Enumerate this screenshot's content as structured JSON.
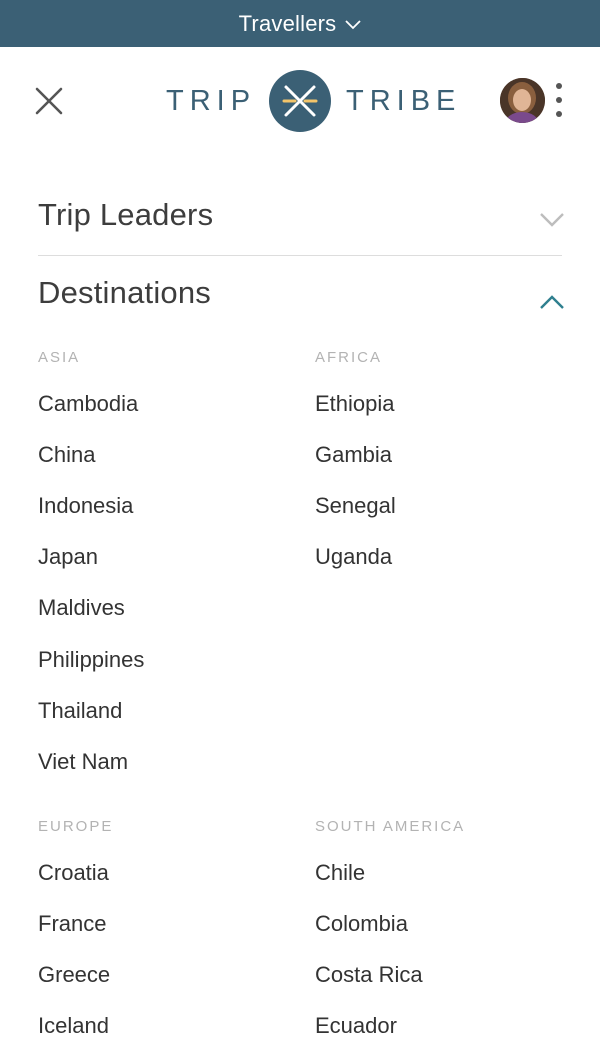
{
  "topbar": {
    "label": "Travellers",
    "icon": "chevron-down-icon"
  },
  "header": {
    "close_icon": "close-icon",
    "logo": {
      "left_word": "TRIP",
      "right_word": "TRIBE",
      "icon": "crossed-arrows-icon"
    },
    "avatar": "user-avatar",
    "menu_icon": "kebab-menu-icon"
  },
  "sections": {
    "trip_leaders": {
      "title": "Trip Leaders",
      "icon": "chevron-down-icon",
      "expanded": false
    },
    "destinations": {
      "title": "Destinations",
      "icon": "chevron-up-icon",
      "expanded": true
    }
  },
  "regions": {
    "asia": {
      "label": "ASIA",
      "items": [
        "Cambodia",
        "China",
        "Indonesia",
        "Japan",
        "Maldives",
        "Philippines",
        "Thailand",
        "Viet Nam"
      ]
    },
    "africa": {
      "label": "AFRICA",
      "items": [
        "Ethiopia",
        "Gambia",
        "Senegal",
        "Uganda"
      ]
    },
    "europe": {
      "label": "EUROPE",
      "items": [
        "Croatia",
        "France",
        "Greece",
        "Iceland"
      ]
    },
    "south_america": {
      "label": "SOUTH AMERICA",
      "items": [
        "Chile",
        "Colombia",
        "Costa Rica",
        "Ecuador"
      ]
    }
  },
  "colors": {
    "brand": "#3b6075",
    "accent_teal": "#2f7f8f",
    "logo_highlight": "#f3c56a"
  }
}
